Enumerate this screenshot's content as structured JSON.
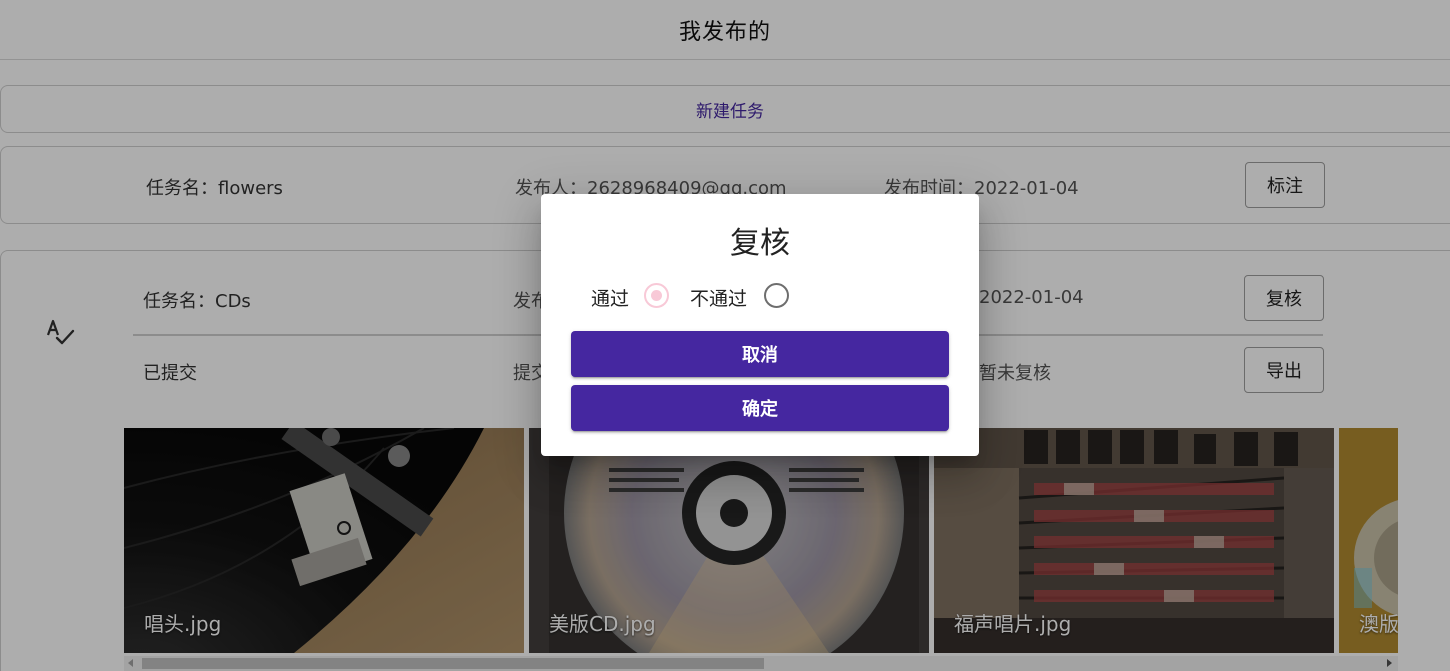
{
  "header": {
    "title": "我发布的"
  },
  "new_task_label": "新建任务",
  "tasks": [
    {
      "name": "任务名：flowers",
      "publisher": "发布人：2628968409@qq.com",
      "publish_time": "发布时间：2022-01-04",
      "action": "标注"
    },
    {
      "name": "任务名：CDs",
      "publisher_partial": "发布",
      "publish_time_partial": "2022-01-04",
      "action": "复核",
      "status": "已提交",
      "submit_partial": "提交",
      "review_status": "暂未复核",
      "export_label": "导出",
      "icon": "spellcheck-icon"
    }
  ],
  "gallery": {
    "images": [
      {
        "caption": "唱头.jpg"
      },
      {
        "caption": "美版CD.jpg"
      },
      {
        "caption": "福声唱片.jpg"
      },
      {
        "caption": "澳版"
      }
    ]
  },
  "dialog": {
    "title": "复核",
    "options": [
      {
        "label": "通过",
        "checked": true
      },
      {
        "label": "不通过",
        "checked": false
      }
    ],
    "cancel_label": "取消",
    "confirm_label": "确定",
    "accent": "#4527a0",
    "radio_checked_color": "#f8c9d7"
  }
}
